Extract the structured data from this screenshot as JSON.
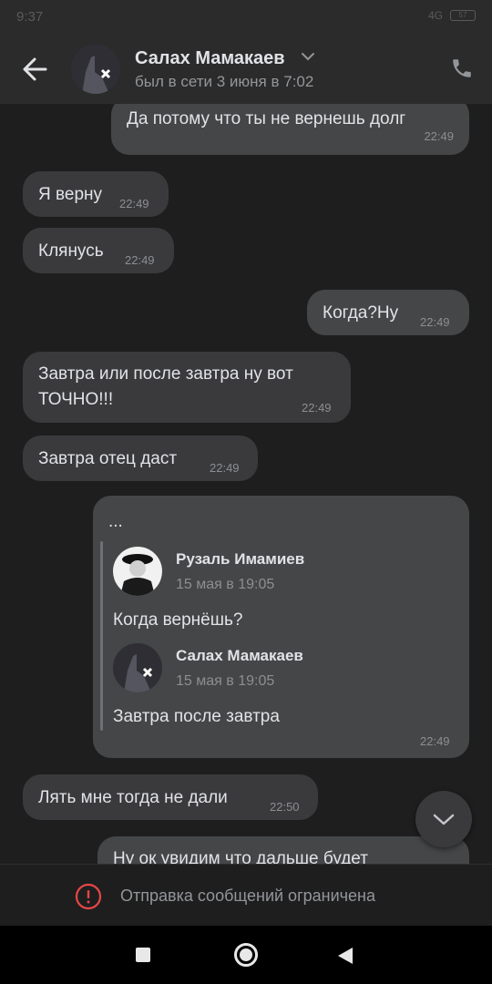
{
  "status_bar": {
    "time": "9:37",
    "network": "4G",
    "battery": "57"
  },
  "header": {
    "name": "Салах Мамакаев",
    "status": "был в сети 3 июня в 7:02"
  },
  "messages": [
    {
      "text": "Да потому что ты не вернешь долг",
      "time": "22:49",
      "dir": "out"
    },
    {
      "text": "Я верну",
      "time": "22:49",
      "dir": "in"
    },
    {
      "text": "Клянусь",
      "time": "22:49",
      "dir": "in"
    },
    {
      "text": "Когда?Ну",
      "time": "22:49",
      "dir": "out"
    },
    {
      "text_line1": "Завтра или после завтра ну вот",
      "text_line2": "ТОЧНО!!!",
      "time": "22:49",
      "dir": "in"
    },
    {
      "text": "Завтра отец даст",
      "time": "22:49",
      "dir": "in"
    },
    {
      "text": "...",
      "time": "22:49",
      "dir": "out",
      "forwarded": [
        {
          "name": "Рузаль Имамиев",
          "date": "15 мая в 19:05",
          "text": "Когда вернёшь?"
        },
        {
          "name": "Салах Мамакаев",
          "date": "15 мая в 19:05",
          "text": "Завтра после завтра"
        }
      ]
    },
    {
      "text": "Лять мне тогда не дали",
      "time": "22:50",
      "dir": "in"
    },
    {
      "text": "Ну ок увидим что дальше будет",
      "dir": "out"
    }
  ],
  "restricted_notice": "Отправка сообщений ограничена",
  "colors": {
    "background": "#1e1e1f",
    "header": "#2b2b2c",
    "bubble_in": "#3a3a3c",
    "bubble_out": "#454647",
    "alert": "#e64646"
  },
  "icons": [
    "back-arrow-icon",
    "chevron-down-icon",
    "phone-icon",
    "scroll-down-icon",
    "alert-icon",
    "nav-recents-icon",
    "nav-home-icon",
    "nav-back-icon"
  ]
}
